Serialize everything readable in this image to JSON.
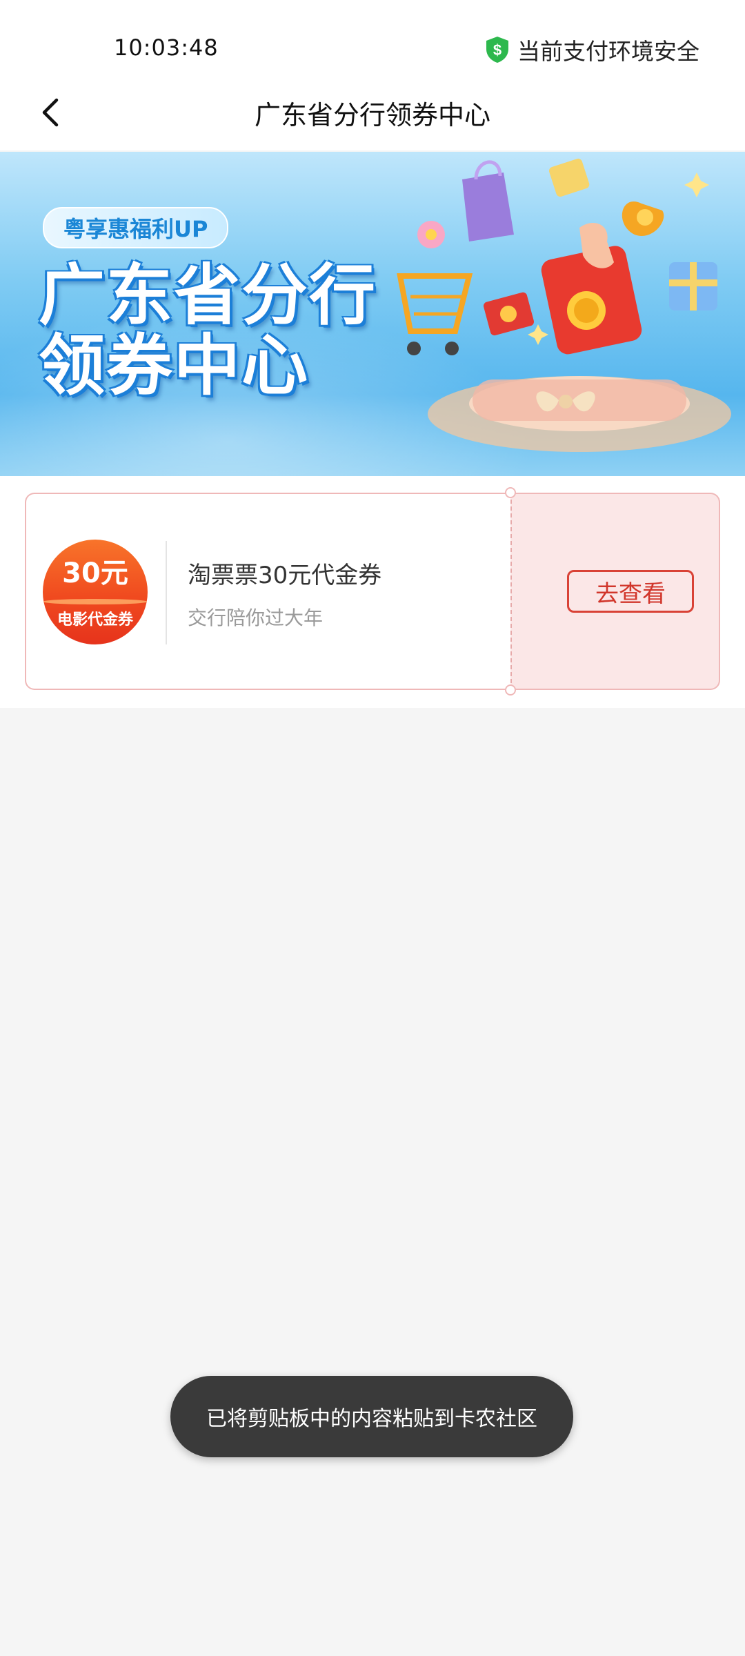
{
  "status_bar": {
    "time": "10:03:48",
    "security_text": "当前支付环境安全",
    "security_icon": "shield-dollar-icon"
  },
  "header": {
    "back_icon": "chevron-left-icon",
    "title": "广东省分行领券中心"
  },
  "banner": {
    "tag": "粤享惠福利UP",
    "title_line1": "广东省分行",
    "title_line2": "领券中心"
  },
  "coupons": [
    {
      "badge_amount": "30元",
      "badge_label": "电影代金券",
      "name": "淘票票30元代金券",
      "subtitle": "交行陪你过大年",
      "action_label": "去查看"
    }
  ],
  "toast": {
    "message": "已将剪贴板中的内容粘贴到卡农社区"
  },
  "colors": {
    "accent_red": "#d94236",
    "banner_blue": "#56b6ee",
    "secure_green": "#2db84d"
  }
}
